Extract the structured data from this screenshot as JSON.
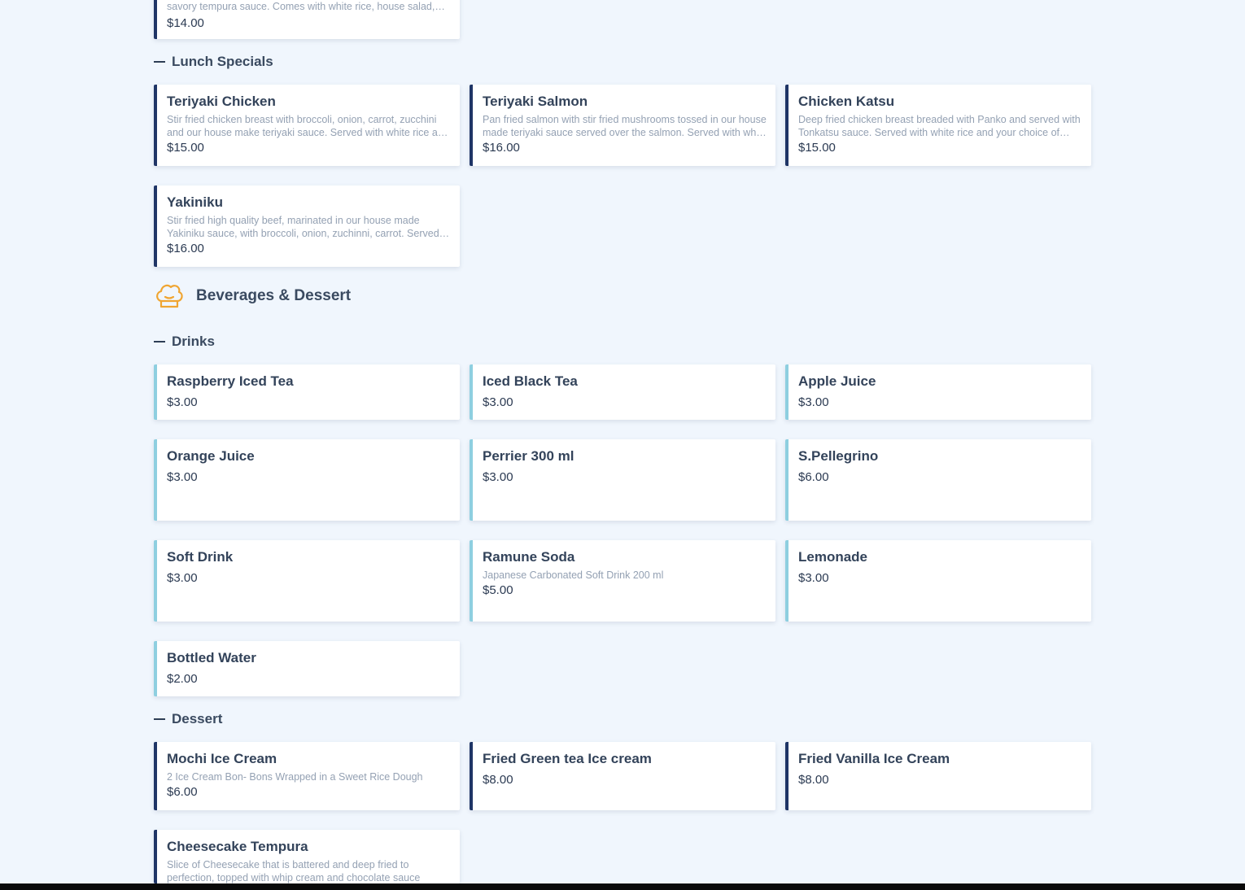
{
  "items": {
    "prev": {
      "desc": "savory tempura sauce. Comes with white rice, house salad, and miso soup.",
      "price": "$14.00"
    },
    "lunch_0": {
      "title": "Teriyaki Chicken",
      "desc": "Stir fried chicken breast with broccoli, onion, carrot, zucchini and our house make teriyaki sauce. Served with white rice and your choice of soup or salad.",
      "price": "$15.00"
    },
    "lunch_1": {
      "title": "Teriyaki Salmon",
      "desc": "Pan fried salmon with stir fried mushrooms tossed in our house made teriyaki sauce served over the salmon. Served with white rice.",
      "price": "$16.00"
    },
    "lunch_2": {
      "title": "Chicken Katsu",
      "desc": "Deep fried chicken breast breaded with Panko and served with Tonkatsu sauce. Served with white rice and your choice of soup or salad.",
      "price": "$15.00"
    },
    "lunch_3": {
      "title": "Yakiniku",
      "desc": "Stir fried high quality beef, marinated in our house made Yakiniku sauce, with broccoli, onion, zuchinni, carrot. Served with white rice.",
      "price": "$16.00"
    },
    "drink_0": {
      "title": "Raspberry Iced Tea",
      "price": "$3.00"
    },
    "drink_1": {
      "title": "Iced Black Tea",
      "price": "$3.00"
    },
    "drink_2": {
      "title": "Apple Juice",
      "price": "$3.00"
    },
    "drink_3": {
      "title": "Orange Juice",
      "price": "$3.00"
    },
    "drink_4": {
      "title": "Perrier 300 ml",
      "price": "$3.00"
    },
    "drink_5": {
      "title": "S.Pellegrino",
      "price": "$6.00"
    },
    "drink_6": {
      "title": "Soft Drink",
      "price": "$3.00"
    },
    "drink_7": {
      "title": "Ramune Soda",
      "desc": "Japanese Carbonated Soft Drink 200 ml",
      "price": "$5.00"
    },
    "drink_8": {
      "title": "Lemonade",
      "price": "$3.00"
    },
    "drink_9": {
      "title": "Bottled Water",
      "price": "$2.00"
    },
    "dessert_0": {
      "title": "Mochi Ice Cream",
      "desc": "2 Ice Cream Bon- Bons Wrapped in a Sweet Rice Dough",
      "price": "$6.00"
    },
    "dessert_1": {
      "title": "Fried Green tea Ice cream",
      "price": "$8.00"
    },
    "dessert_2": {
      "title": "Fried Vanilla Ice Cream",
      "price": "$8.00"
    },
    "dessert_3": {
      "title": "Cheesecake Tempura",
      "desc": "Slice of Cheesecake that is battered and deep fried to perfection, topped with whip cream and chocolate sauce"
    }
  },
  "subcategories": {
    "lunch": "Lunch Specials",
    "drinks": "Drinks",
    "dessert": "Dessert"
  },
  "sections": {
    "beverages": {
      "label": "Beverages & Dessert",
      "icon": "chef-hat-icon",
      "icon_color": "#f0a531"
    }
  },
  "colors": {
    "background": "#f0f6fd",
    "food_accent": "#1f3566",
    "drink_accent": "#8ecfe0"
  }
}
